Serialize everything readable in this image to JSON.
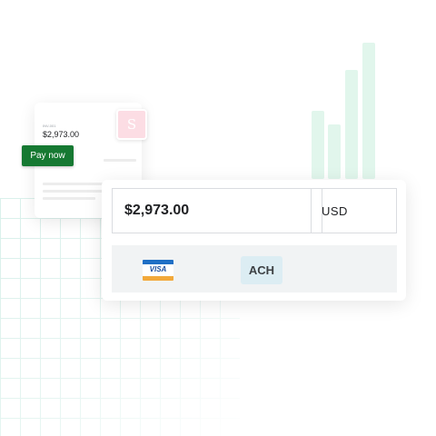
{
  "invoice": {
    "label": "INV-001",
    "amount": "$2,973.00",
    "avatar_letter": "S",
    "pay_button_label": "Pay now"
  },
  "payment": {
    "amount_value": "$2,973.00",
    "currency": "USD",
    "methods": [
      {
        "name": "card",
        "label": "VISA"
      },
      {
        "name": "bank",
        "label": "ACH"
      }
    ]
  },
  "colors": {
    "pay_button": "#167932",
    "visa_blue": "#1f6fc5",
    "visa_gold": "#f2a93b",
    "ach_badge": "#dcedf3",
    "chart_bar": "#e1f6ec",
    "grid_line": "#d6efe9"
  }
}
